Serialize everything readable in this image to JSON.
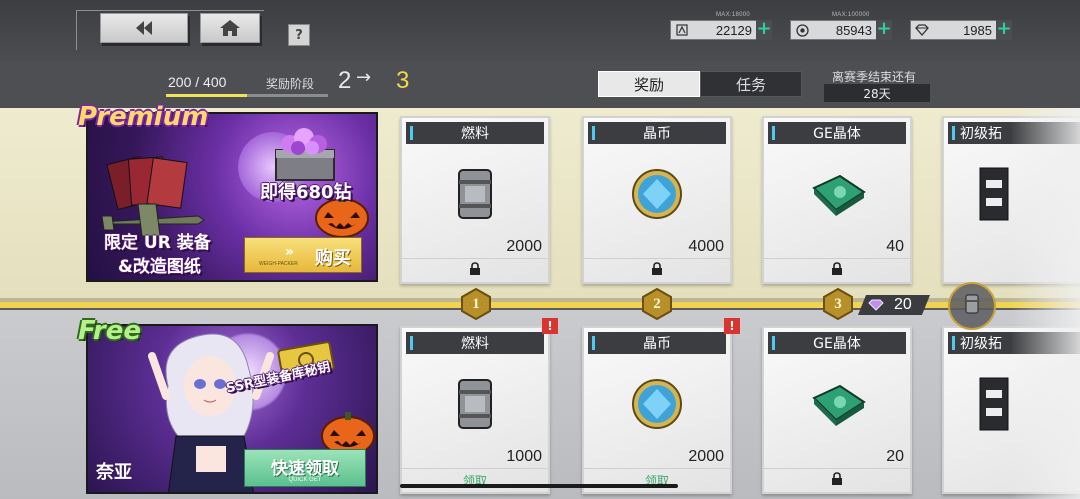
{
  "header": {
    "back_icon": "back-arrow-icon",
    "home_icon": "home-icon",
    "help_label": "?"
  },
  "resources": [
    {
      "name": "fuel",
      "icon": "fuel-icon",
      "max": "MAX:18000",
      "value": "22129",
      "plus": "+"
    },
    {
      "name": "coin",
      "icon": "coin-icon",
      "max": "MAX:100000",
      "value": "85943",
      "plus": "+"
    },
    {
      "name": "diamond",
      "icon": "diamond-icon",
      "max": "",
      "value": "1985",
      "plus": "+"
    }
  ],
  "progress": {
    "text": "200 / 400",
    "fraction": 0.5,
    "stage_label": "奖励阶段",
    "stage_from": "2",
    "stage_arrow": "→",
    "stage_to": "3"
  },
  "tabs": [
    {
      "label": "奖励",
      "active": true
    },
    {
      "label": "任务",
      "active": false
    }
  ],
  "season": {
    "label": "离赛季结束还有",
    "days": "28天"
  },
  "premium": {
    "tag": "Premium",
    "promo_line1": "即得680钻",
    "promo_line2": "限定 UR 装备",
    "promo_line3": "&改造图纸",
    "buy_label": "购买",
    "buy_sub": "WEIGH-PACKER"
  },
  "free": {
    "tag": "Free",
    "promo_line": "SSR型装备库秘钥",
    "character_name": "奈亚",
    "quick_label": "快速领取",
    "quick_sub": "QUICK GET"
  },
  "premium_rewards": [
    {
      "title": "燃料",
      "qty": "2000",
      "icon": "fuel-barrel-icon",
      "status": "locked"
    },
    {
      "title": "晶币",
      "qty": "4000",
      "icon": "crystal-coin-icon",
      "status": "locked"
    },
    {
      "title": "GE晶体",
      "qty": "40",
      "icon": "ge-crystal-icon",
      "status": "locked"
    },
    {
      "title": "初级拓",
      "qty": "",
      "icon": "expansion-icon",
      "status": ""
    }
  ],
  "free_rewards": [
    {
      "title": "燃料",
      "qty": "1000",
      "icon": "fuel-barrel-icon",
      "status": "claim",
      "claim_label": "领取",
      "alert": "!"
    },
    {
      "title": "晶币",
      "qty": "2000",
      "icon": "crystal-coin-icon",
      "status": "claim",
      "claim_label": "领取",
      "alert": "!"
    },
    {
      "title": "GE晶体",
      "qty": "20",
      "icon": "ge-crystal-icon",
      "status": "locked",
      "claim_label": ""
    },
    {
      "title": "初级拓",
      "qty": "",
      "icon": "expansion-icon",
      "status": "",
      "claim_label": ""
    }
  ],
  "levels": [
    "1",
    "2",
    "3"
  ],
  "level_bonus": {
    "icon": "diamond-icon",
    "value": "20"
  },
  "colors": {
    "accent_gold": "#f2d34f",
    "claim_green": "#3da86a",
    "alert_red": "#d9342f",
    "plus_teal": "#2fd0a0"
  }
}
